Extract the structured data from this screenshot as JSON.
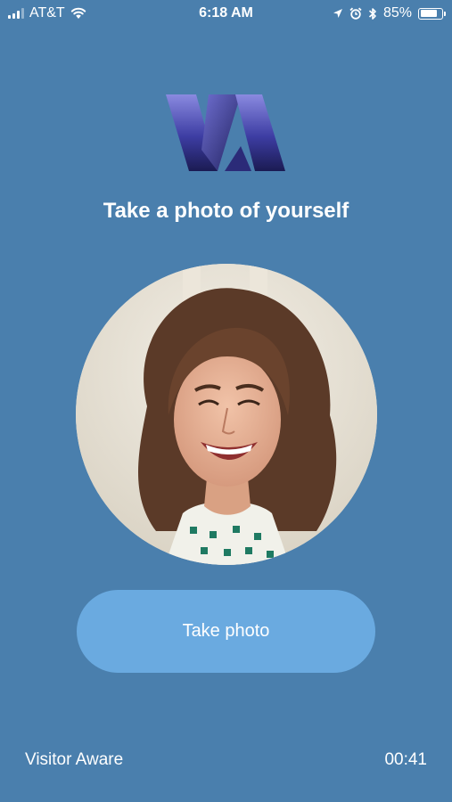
{
  "status_bar": {
    "carrier": "AT&T",
    "time": "6:18 AM",
    "battery_percent": "85%",
    "battery_level": 0.85,
    "icons": [
      "signal-icon",
      "wifi-icon",
      "location-icon",
      "alarm-icon",
      "bluetooth-icon",
      "battery-icon"
    ]
  },
  "logo": {
    "icon": "visitor-aware-logo",
    "colors": [
      "#1c1c4f",
      "#3b3b9a",
      "#7a7ad6"
    ]
  },
  "page": {
    "title": "Take a photo of yourself"
  },
  "photo": {
    "icon": "user-photo"
  },
  "actions": {
    "take_photo_label": "Take photo"
  },
  "footer": {
    "app_name": "Visitor Aware",
    "timer": "00:41"
  },
  "colors": {
    "background": "#4a7fad",
    "button": "#6aaae0",
    "text": "#ffffff"
  }
}
